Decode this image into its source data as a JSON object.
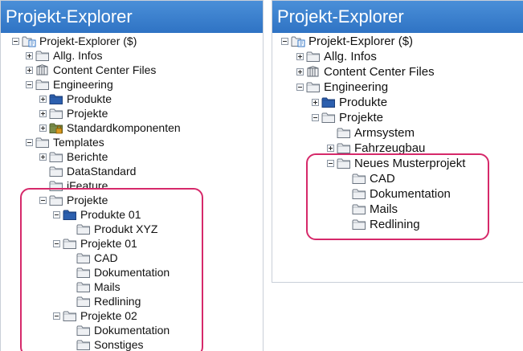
{
  "colors": {
    "titlebar": "#3a80cf",
    "highlight": "#d6296a",
    "folder_gray": "#eef0f3",
    "folder_blue": "#2c5fae"
  },
  "left_panel": {
    "title": "Projekt-Explorer",
    "nodes": [
      {
        "label": "Projekt-Explorer ($)",
        "icon": "project-root-icon",
        "depth": 0,
        "expander": "minus"
      },
      {
        "label": "Allg. Infos",
        "icon": "folder-icon",
        "depth": 1,
        "expander": "plus"
      },
      {
        "label": "Content Center Files",
        "icon": "library-icon",
        "depth": 1,
        "expander": "plus"
      },
      {
        "label": "Engineering",
        "icon": "folder-icon",
        "depth": 1,
        "expander": "minus"
      },
      {
        "label": "Produkte",
        "icon": "folder-blue-icon",
        "depth": 2,
        "expander": "plus"
      },
      {
        "label": "Projekte",
        "icon": "folder-icon",
        "depth": 2,
        "expander": "plus"
      },
      {
        "label": "Standardkomponenten",
        "icon": "folder-locked-icon",
        "depth": 2,
        "expander": "plus"
      },
      {
        "label": "Templates",
        "icon": "folder-icon",
        "depth": 1,
        "expander": "minus"
      },
      {
        "label": "Berichte",
        "icon": "folder-icon",
        "depth": 2,
        "expander": "plus"
      },
      {
        "label": "DataStandard",
        "icon": "folder-icon",
        "depth": 2,
        "expander": "none"
      },
      {
        "label": "iFeature",
        "icon": "folder-icon",
        "depth": 2,
        "expander": "none"
      },
      {
        "label": "Projekte",
        "icon": "folder-icon",
        "depth": 2,
        "expander": "minus"
      },
      {
        "label": "Produkte 01",
        "icon": "folder-blue-icon",
        "depth": 3,
        "expander": "minus"
      },
      {
        "label": "Produkt XYZ",
        "icon": "folder-icon",
        "depth": 4,
        "expander": "none"
      },
      {
        "label": "Projekte 01",
        "icon": "folder-icon",
        "depth": 3,
        "expander": "minus"
      },
      {
        "label": "CAD",
        "icon": "folder-icon",
        "depth": 4,
        "expander": "none"
      },
      {
        "label": "Dokumentation",
        "icon": "folder-icon",
        "depth": 4,
        "expander": "none"
      },
      {
        "label": "Mails",
        "icon": "folder-icon",
        "depth": 4,
        "expander": "none"
      },
      {
        "label": "Redlining",
        "icon": "folder-icon",
        "depth": 4,
        "expander": "none"
      },
      {
        "label": "Projekte 02",
        "icon": "folder-icon",
        "depth": 3,
        "expander": "minus"
      },
      {
        "label": "Dokumentation",
        "icon": "folder-icon",
        "depth": 4,
        "expander": "none"
      },
      {
        "label": "Sonstiges",
        "icon": "folder-icon",
        "depth": 4,
        "expander": "none"
      }
    ]
  },
  "right_panel": {
    "title": "Projekt-Explorer",
    "nodes": [
      {
        "label": "Projekt-Explorer ($)",
        "icon": "project-root-icon",
        "depth": 0,
        "expander": "minus"
      },
      {
        "label": "Allg. Infos",
        "icon": "folder-icon",
        "depth": 1,
        "expander": "plus"
      },
      {
        "label": "Content Center Files",
        "icon": "library-icon",
        "depth": 1,
        "expander": "plus"
      },
      {
        "label": "Engineering",
        "icon": "folder-icon",
        "depth": 1,
        "expander": "minus"
      },
      {
        "label": "Produkte",
        "icon": "folder-blue-icon",
        "depth": 2,
        "expander": "plus"
      },
      {
        "label": "Projekte",
        "icon": "folder-icon",
        "depth": 2,
        "expander": "minus"
      },
      {
        "label": "Armsystem",
        "icon": "folder-icon",
        "depth": 3,
        "expander": "none"
      },
      {
        "label": "Fahrzeugbau",
        "icon": "folder-icon",
        "depth": 3,
        "expander": "plus"
      },
      {
        "label": "Neues Musterprojekt",
        "icon": "folder-icon",
        "depth": 3,
        "expander": "minus"
      },
      {
        "label": "CAD",
        "icon": "folder-icon",
        "depth": 4,
        "expander": "none"
      },
      {
        "label": "Dokumentation",
        "icon": "folder-icon",
        "depth": 4,
        "expander": "none"
      },
      {
        "label": "Mails",
        "icon": "folder-icon",
        "depth": 4,
        "expander": "none"
      },
      {
        "label": "Redlining",
        "icon": "folder-icon",
        "depth": 4,
        "expander": "none"
      }
    ]
  }
}
